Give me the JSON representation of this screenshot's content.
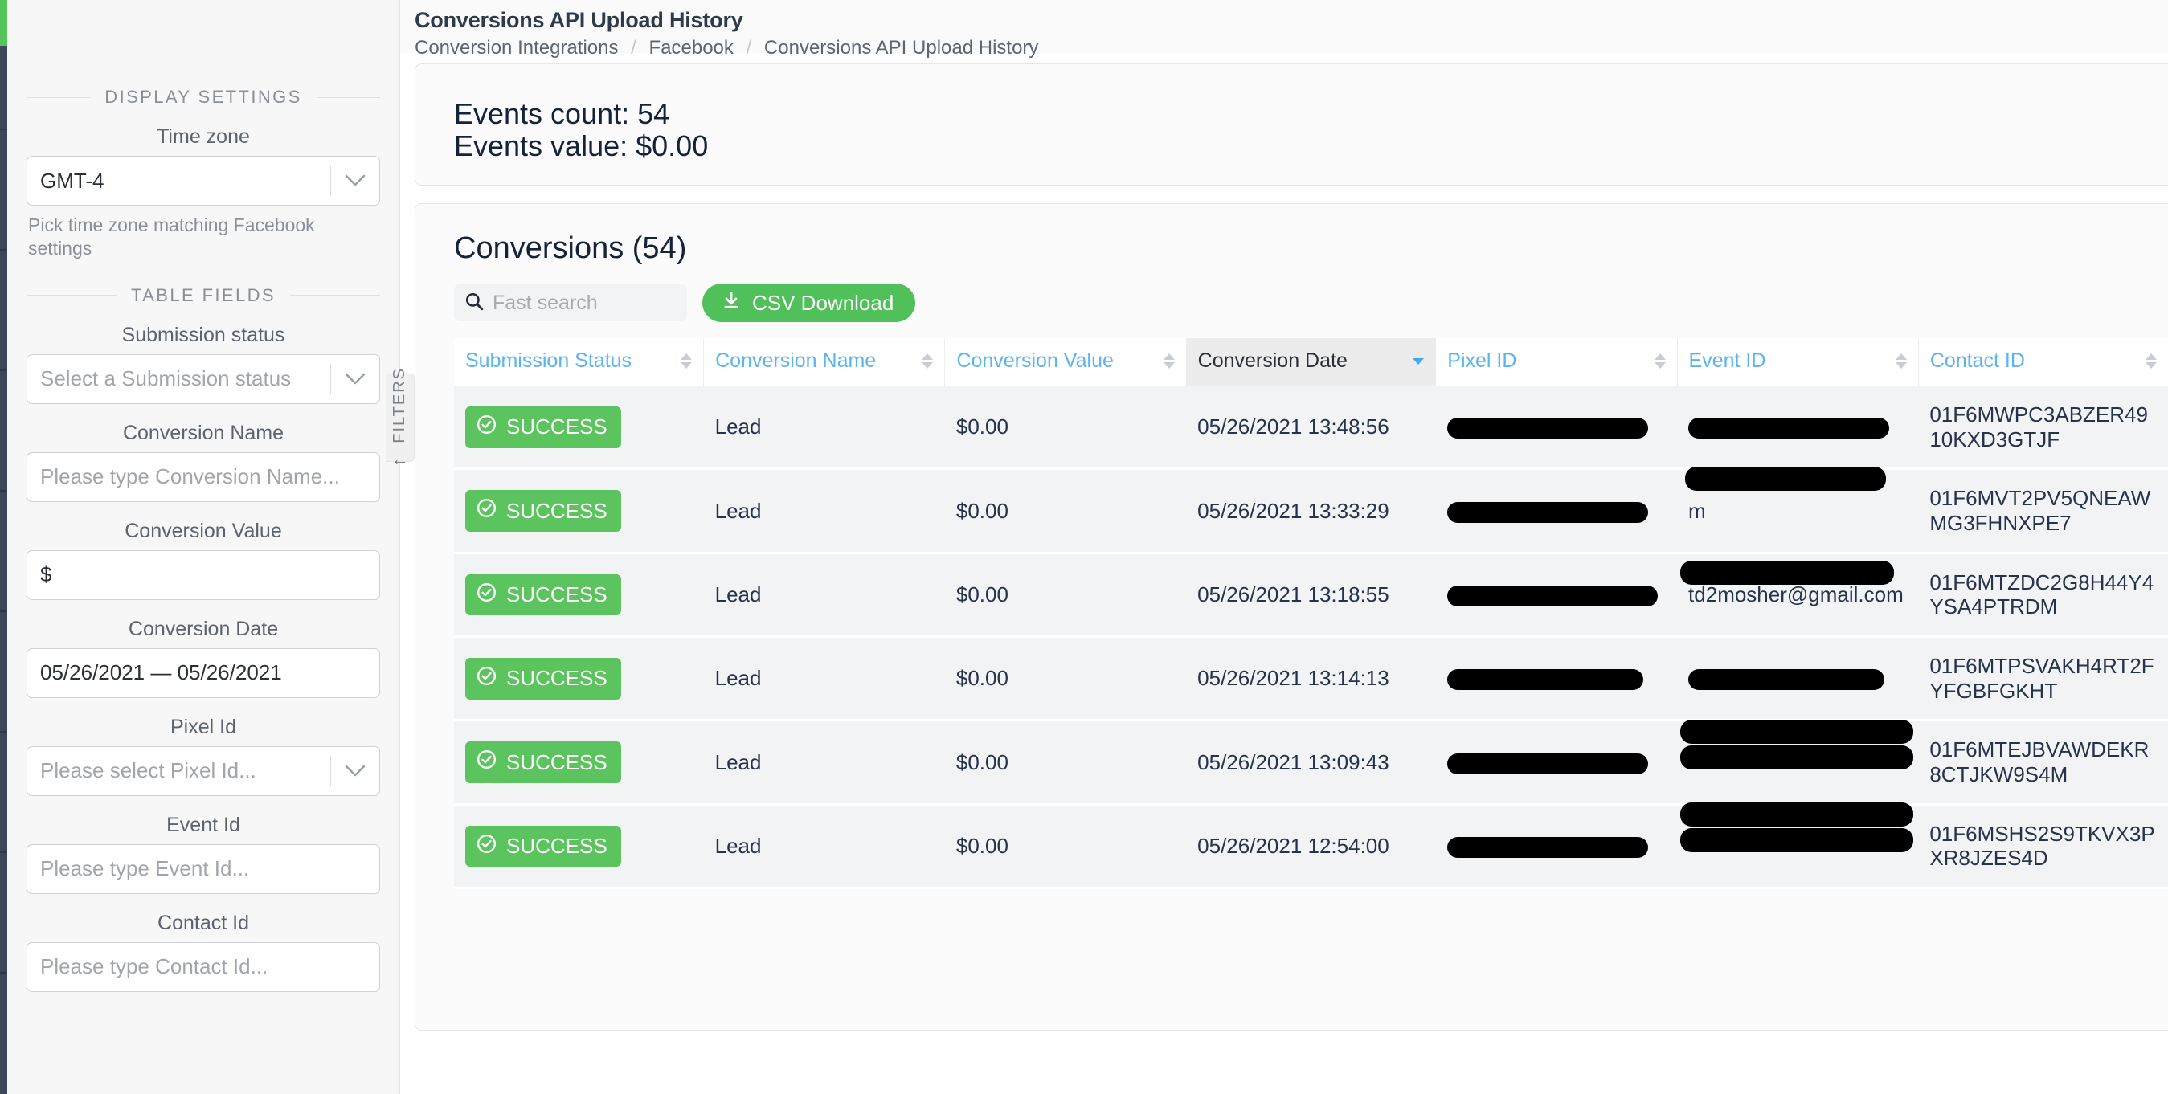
{
  "rail": {
    "accent_color": "#55c45a",
    "bg_color": "#3c4858"
  },
  "header": {
    "title": "Conversions API Upload History",
    "breadcrumbs": [
      "Conversion Integrations",
      "Facebook",
      "Conversions API Upload History"
    ],
    "breadcrumb_separator": "/"
  },
  "sidebar": {
    "sections": [
      {
        "label": "DISPLAY SETTINGS"
      },
      {
        "label": "TABLE FIELDS"
      }
    ],
    "timezone": {
      "label": "Time zone",
      "value": "GMT-4",
      "help": "Pick time zone matching Facebook settings"
    },
    "submission_status": {
      "label": "Submission status",
      "placeholder": "Select a Submission status"
    },
    "conversion_name": {
      "label": "Conversion Name",
      "placeholder": "Please type Conversion Name..."
    },
    "conversion_value": {
      "label": "Conversion Value",
      "value": "$"
    },
    "conversion_date": {
      "label": "Conversion Date",
      "value": "05/26/2021 — 05/26/2021"
    },
    "pixel_id": {
      "label": "Pixel Id",
      "placeholder": "Please select Pixel Id..."
    },
    "event_id": {
      "label": "Event Id",
      "placeholder": "Please type Event Id..."
    },
    "contact_id": {
      "label": "Contact Id",
      "placeholder": "Please type Contact Id..."
    }
  },
  "filters_tab": {
    "label": "FILTERS",
    "arrow": "←"
  },
  "summary": {
    "events_count_line": "Events count: 54",
    "events_value_line": "Events value: $0.00",
    "events_count": 54,
    "events_value": "$0.00"
  },
  "table_card": {
    "title": "Conversions (54)",
    "search_placeholder": "Fast search",
    "search_value": "",
    "csv_button": "CSV Download",
    "columns": [
      {
        "label": "Submission Status",
        "sorted": false
      },
      {
        "label": "Conversion Name",
        "sorted": false
      },
      {
        "label": "Conversion Value",
        "sorted": false
      },
      {
        "label": "Conversion Date",
        "sorted": true,
        "direction": "desc"
      },
      {
        "label": "Pixel ID",
        "sorted": false
      },
      {
        "label": "Event ID",
        "sorted": false
      },
      {
        "label": "Contact ID",
        "sorted": false
      }
    ],
    "rows": [
      {
        "status": "SUCCESS",
        "conversion_name": "Lead",
        "conversion_value": "$0.00",
        "conversion_date": "05/26/2021 13:48:56",
        "pixel_id": "",
        "event_id": "",
        "contact_id": "01F6MWPC3ABZER4910KXD3GTJF"
      },
      {
        "status": "SUCCESS",
        "conversion_name": "Lead",
        "conversion_value": "$0.00",
        "conversion_date": "05/26/2021 13:33:29",
        "pixel_id": "",
        "event_id": "m",
        "contact_id": "01F6MVT2PV5QNEAWMG3FHNXPE7"
      },
      {
        "status": "SUCCESS",
        "conversion_name": "Lead",
        "conversion_value": "$0.00",
        "conversion_date": "05/26/2021 13:18:55",
        "pixel_id": "",
        "event_id": "td2mosher@gmail.com",
        "contact_id": "01F6MTZDC2G8H44Y4YSA4PTRDM"
      },
      {
        "status": "SUCCESS",
        "conversion_name": "Lead",
        "conversion_value": "$0.00",
        "conversion_date": "05/26/2021 13:14:13",
        "pixel_id": "",
        "event_id": "",
        "contact_id": "01F6MTPSVAKH4RT2FYFGBFGKHT"
      },
      {
        "status": "SUCCESS",
        "conversion_name": "Lead",
        "conversion_value": "$0.00",
        "conversion_date": "05/26/2021 13:09:43",
        "pixel_id": "",
        "event_id": "",
        "contact_id": "01F6MTEJBVAWDEKR8CTJKW9S4M"
      },
      {
        "status": "SUCCESS",
        "conversion_name": "Lead",
        "conversion_value": "$0.00",
        "conversion_date": "05/26/2021 12:54:00",
        "pixel_id": "",
        "event_id": "",
        "contact_id": "01F6MSHS2S9TKVX3PXR8JZES4D"
      }
    ]
  }
}
